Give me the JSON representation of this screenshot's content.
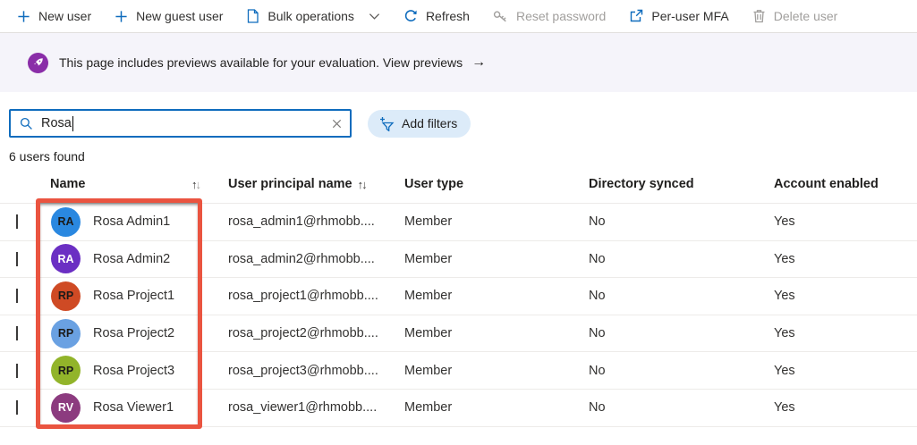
{
  "toolbar": {
    "items": [
      {
        "label": "New user",
        "icon": "plus-icon",
        "enabled": true
      },
      {
        "label": "New guest user",
        "icon": "plus-icon",
        "enabled": true
      },
      {
        "label": "Bulk operations",
        "icon": "document-icon",
        "enabled": true,
        "has_dropdown": true
      },
      {
        "label": "Refresh",
        "icon": "refresh-icon",
        "enabled": true
      },
      {
        "label": "Reset password",
        "icon": "key-icon",
        "enabled": false
      },
      {
        "label": "Per-user MFA",
        "icon": "external-link-icon",
        "enabled": true
      },
      {
        "label": "Delete user",
        "icon": "trash-icon",
        "enabled": false
      }
    ]
  },
  "banner": {
    "icon": "rocket-icon",
    "icon_color": "#8a2da8",
    "bg_color": "#f5f4fa",
    "text": "This page includes previews available for your evaluation. View previews",
    "arrow": "→"
  },
  "search": {
    "value": "Rosa",
    "icon": "search-icon",
    "clear_icon": "close-icon",
    "focus_border_color": "#0f6cbd"
  },
  "filters": {
    "add_filters_label": "Add filters",
    "icon": "add-filter-icon"
  },
  "results": {
    "count_text": "6 users found"
  },
  "table": {
    "sort_icons": {
      "up": "↑",
      "down": "↓"
    },
    "columns": [
      {
        "label": "Name",
        "sorted": true
      },
      {
        "label": "User principal name",
        "sorted": true
      },
      {
        "label": "User type"
      },
      {
        "label": "Directory synced"
      },
      {
        "label": "Account enabled"
      }
    ],
    "rows": [
      {
        "checked": false,
        "initials": "RA",
        "avatar_color": "#2a88e0",
        "initials_color": "#1b1a19",
        "name": "Rosa Admin1",
        "upn": "rosa_admin1@rhmobb....",
        "user_type": "Member",
        "directory_synced": "No",
        "account_enabled": "Yes"
      },
      {
        "checked": false,
        "initials": "RA",
        "avatar_color": "#6b2fc3",
        "initials_color": "#ffffff",
        "name": "Rosa Admin2",
        "upn": "rosa_admin2@rhmobb....",
        "user_type": "Member",
        "directory_synced": "No",
        "account_enabled": "Yes"
      },
      {
        "checked": false,
        "initials": "RP",
        "avatar_color": "#cf4a24",
        "initials_color": "#1b1a19",
        "name": "Rosa Project1",
        "upn": "rosa_project1@rhmobb....",
        "user_type": "Member",
        "directory_synced": "No",
        "account_enabled": "Yes"
      },
      {
        "checked": false,
        "initials": "RP",
        "avatar_color": "#6aa1e2",
        "initials_color": "#1b1a19",
        "name": "Rosa Project2",
        "upn": "rosa_project2@rhmobb....",
        "user_type": "Member",
        "directory_synced": "No",
        "account_enabled": "Yes"
      },
      {
        "checked": false,
        "initials": "RP",
        "avatar_color": "#92b42a",
        "initials_color": "#1b1a19",
        "name": "Rosa Project3",
        "upn": "rosa_project3@rhmobb....",
        "user_type": "Member",
        "directory_synced": "No",
        "account_enabled": "Yes"
      },
      {
        "checked": false,
        "initials": "RV",
        "avatar_color": "#8c3b7f",
        "initials_color": "#ffffff",
        "name": "Rosa Viewer1",
        "upn": "rosa_viewer1@rhmobb....",
        "user_type": "Member",
        "directory_synced": "No",
        "account_enabled": "Yes"
      }
    ]
  },
  "annotation": {
    "shape": "rectangle",
    "color": "#ea5440"
  }
}
